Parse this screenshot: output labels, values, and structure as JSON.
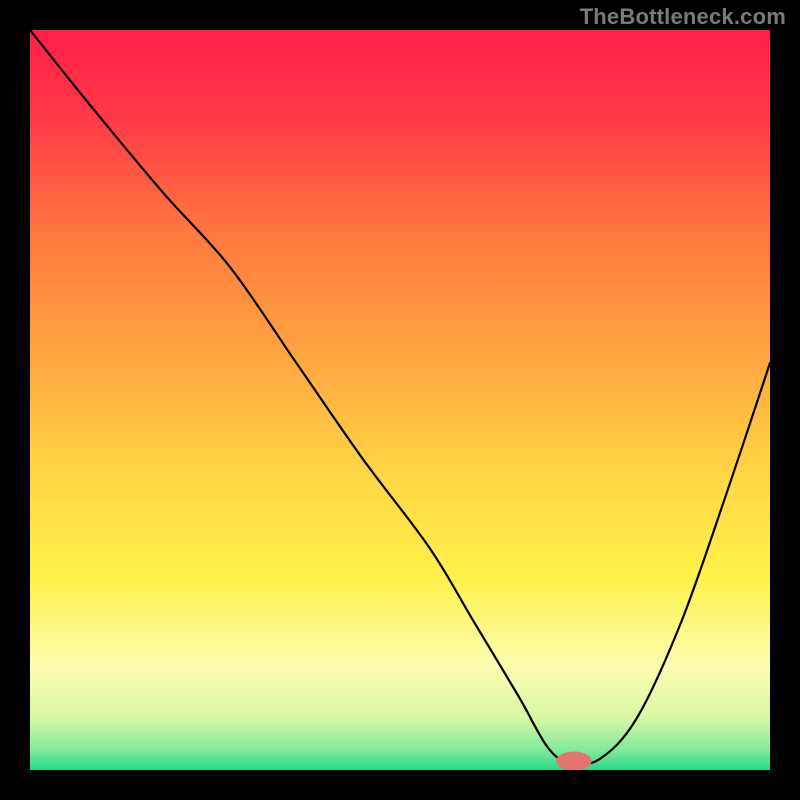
{
  "watermark": "TheBottleneck.com",
  "chart_data": {
    "type": "line",
    "title": "",
    "xlabel": "",
    "ylabel": "",
    "xlim": [
      0,
      100
    ],
    "ylim": [
      0,
      100
    ],
    "grid": false,
    "series": [
      {
        "name": "bottleneck-curve",
        "x": [
          0,
          8,
          18,
          27,
          36,
          45,
          54,
          60,
          66,
          70,
          73,
          77,
          82,
          88,
          94,
          100
        ],
        "y": [
          100,
          90,
          78,
          68,
          55,
          42,
          30,
          20,
          10,
          3,
          1,
          1.5,
          7,
          20,
          37,
          55
        ]
      }
    ],
    "marker": {
      "x": 73.5,
      "y": 1.2,
      "color": "#e5746e",
      "rx": 2.4,
      "ry": 1.3
    },
    "background_gradient": {
      "stops": [
        {
          "offset": 0.0,
          "color": "#ff1f4b"
        },
        {
          "offset": 0.12,
          "color": "#ff3a46"
        },
        {
          "offset": 0.28,
          "color": "#ff7a3e"
        },
        {
          "offset": 0.44,
          "color": "#ffa540"
        },
        {
          "offset": 0.6,
          "color": "#ffd645"
        },
        {
          "offset": 0.74,
          "color": "#fff14a"
        },
        {
          "offset": 0.86,
          "color": "#fdfdb0"
        },
        {
          "offset": 0.93,
          "color": "#d8f7a6"
        },
        {
          "offset": 0.975,
          "color": "#7ce99a"
        },
        {
          "offset": 1.0,
          "color": "#25d986"
        }
      ]
    }
  }
}
